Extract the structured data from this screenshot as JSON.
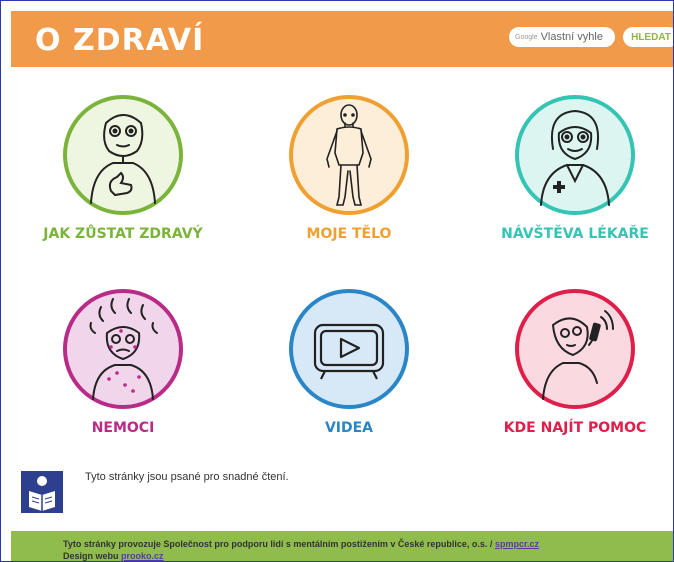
{
  "header": {
    "title": "O ZDRAVÍ",
    "search_brand": "Google",
    "search_placeholder": "Vlastní vyhle",
    "search_button": "HLEDAT"
  },
  "tiles": [
    {
      "label": "JAK ZŮSTAT ZDRAVÝ",
      "color": "#7bb43a",
      "bg": "#eef6e2"
    },
    {
      "label": "MOJE TĚLO",
      "color": "#f0a030",
      "bg": "#fdeed9"
    },
    {
      "label": "NÁVŠTĚVA LÉKAŘE",
      "color": "#35c4b4",
      "bg": "#dcf5f1"
    },
    {
      "label": "NEMOCI",
      "color": "#b82b86",
      "bg": "#f1d5ea"
    },
    {
      "label": "VIDEA",
      "color": "#2a86c6",
      "bg": "#d7e9f6"
    },
    {
      "label": "KDE NAJÍT POMOC",
      "color": "#e01e4a",
      "bg": "#fbd9e0"
    }
  ],
  "easy_read": {
    "text": "Tyto stránky jsou psané pro snadné čtení."
  },
  "footer": {
    "line1_text": "Tyto stránky provozuje Společnost pro podporu lidí s mentálním postižením v České republice, o.s. /",
    "line1_link": "spmpcr.cz",
    "line2_text": "Design webu",
    "line2_link": "prooko.cz"
  }
}
